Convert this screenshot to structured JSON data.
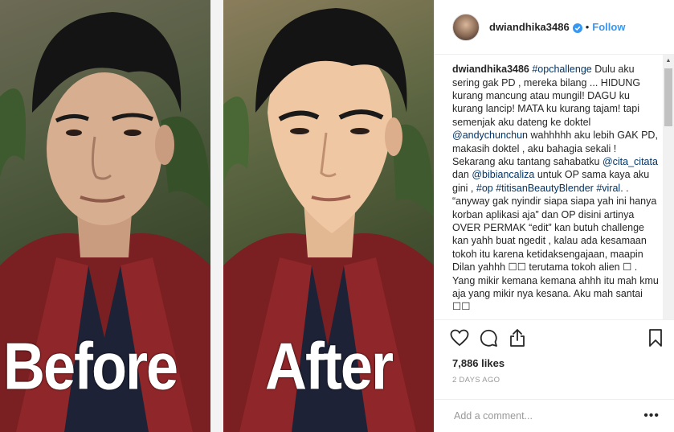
{
  "media": {
    "before_label": "Before",
    "after_label": "After"
  },
  "header": {
    "username": "dwiandhika3486",
    "separator": "•",
    "follow_label": "Follow"
  },
  "caption": {
    "username": "dwiandhika3486",
    "segments": [
      {
        "type": "tag",
        "text": "#opchallenge"
      },
      {
        "type": "text",
        "text": " Dulu aku sering gak PD , mereka bilang ... HIDUNG kurang mancung atau mungil! DAGU ku kurang lancip! MATA ku kurang tajam! tapi semenjak aku dateng ke doktel "
      },
      {
        "type": "tag",
        "text": "@andychunchun"
      },
      {
        "type": "text",
        "text": " wahhhhh aku lebih GAK PD, makasih doktel , aku bahagia sekali ! Sekarang aku tantang sahabatku "
      },
      {
        "type": "tag",
        "text": "@cita_citata"
      },
      {
        "type": "text",
        "text": " dan "
      },
      {
        "type": "tag",
        "text": "@bibiancaliza"
      },
      {
        "type": "text",
        "text": " untuk OP sama kaya aku gini , "
      },
      {
        "type": "tag",
        "text": "#op"
      },
      {
        "type": "text",
        "text": " "
      },
      {
        "type": "tag",
        "text": "#titisanBeautyBlender"
      },
      {
        "type": "text",
        "text": " "
      },
      {
        "type": "tag",
        "text": "#viral"
      },
      {
        "type": "text",
        "text": ". . “anyway gak nyindir siapa siapa yah ini hanya korban aplikasi aja” dan OP disini artinya OVER PERMAK “edit” kan butuh challenge kan yahh buat ngedit , kalau ada kesamaan tokoh itu karena ketidaksengajaan, maapin Dilan yahhh ☐☐ terutama tokoh alien ☐ . Yang mikir kemana kemana ahhh itu mah kmu aja yang mikir nya kesana. Aku mah santai ☐☐"
      }
    ]
  },
  "scrollbar": {
    "up": "▲",
    "down": "▼"
  },
  "actions": {
    "like_icon": "heart-icon",
    "comment_icon": "comment-icon",
    "share_icon": "share-icon",
    "save_icon": "bookmark-icon"
  },
  "likes": "7,886 likes",
  "timestamp": "2 DAYS AGO",
  "comment": {
    "placeholder": "Add a comment...",
    "more": "•••"
  },
  "colors": {
    "link": "#003569",
    "follow": "#3897f0",
    "muted": "#999999",
    "text": "#262626"
  }
}
